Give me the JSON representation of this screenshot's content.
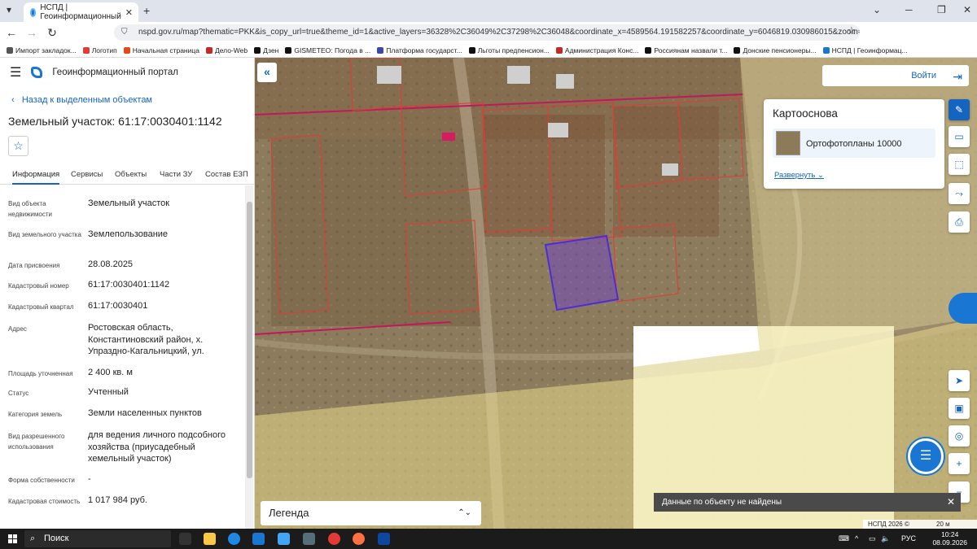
{
  "browser": {
    "tab_title": "НСПД | Геоинформационный",
    "url": "nspd.gov.ru/map?thematic=PKK&is_copy_url=true&theme_id=1&active_layers=36328%2C36049%2C37298%2C36048&coordinate_x=4589564.191582257&coordinate_y=6046819.030986015&zoom=18&baseLayerId=36345",
    "bookmarks": [
      "Импорт закладок...",
      "Логотип",
      "Начальная страница",
      "Дело-Web",
      "Дзен",
      "GISMETEO: Погода в ...",
      "Платформа государст...",
      "Льготы предпенсион...",
      "Администрация Конс...",
      "Россиянам назвали т...",
      "Донские пенсионеры...",
      "НСПД | Геоинформац..."
    ]
  },
  "sidebar": {
    "portal_title": "Геоинформационный портал",
    "back_link": "Назад к выделенным объектам",
    "object_title": "Земельный участок: 61:17:0030401:1142",
    "tabs": [
      "Информация",
      "Сервисы",
      "Объекты",
      "Части ЗУ",
      "Состав ЕЗП"
    ],
    "active_tab": "Информация",
    "rows": [
      {
        "key": "Вид объекта недвижимости",
        "value": "Земельный участок"
      },
      {
        "key": "Вид земельного участка",
        "value": "Землепользование"
      },
      {
        "key": "Дата присвоения",
        "value": "28.08.2025"
      },
      {
        "key": "Кадастровый номер",
        "value": "61:17:0030401:1142"
      },
      {
        "key": "Кадастровый квартал",
        "value": "61:17:0030401"
      },
      {
        "key": "Адрес",
        "value": "Ростовская область, Константиновский район, х. Упраздно-Кагальницкий, ул."
      },
      {
        "key": "Площадь уточненная",
        "value": "2 400 кв. м"
      },
      {
        "key": "Статус",
        "value": "Учтенный"
      },
      {
        "key": "Категория земель",
        "value": "Земли населенных пунктов"
      },
      {
        "key": "Вид разрешенного использования",
        "value": "для ведения личного подсобного хозяйства (приусадебный хемельный участок)"
      },
      {
        "key": "Форма собственности",
        "value": "-"
      },
      {
        "key": "Кадастровая стоимость",
        "value": "1 017 984 руб."
      }
    ]
  },
  "map": {
    "login_label": "Войти",
    "basemap_title": "Картооснова",
    "basemap_layer": "Ортофотопланы 10000",
    "expand_label": "Развернуть",
    "legend_label": "Легенда",
    "toast_message": "Данные по объекту не найдены",
    "attribution": "НСПД 2026 ©",
    "scale_label": "20 м",
    "colors": {
      "parcel_highlight": "#6a3fd1",
      "parcel_border": "#e53935",
      "zone_fill": "#f3e9a3",
      "accent": "#1565c0"
    }
  },
  "taskbar": {
    "search_label": "Поиск",
    "lang": "РУС",
    "time": "10:24",
    "date": "08.09.2026"
  }
}
